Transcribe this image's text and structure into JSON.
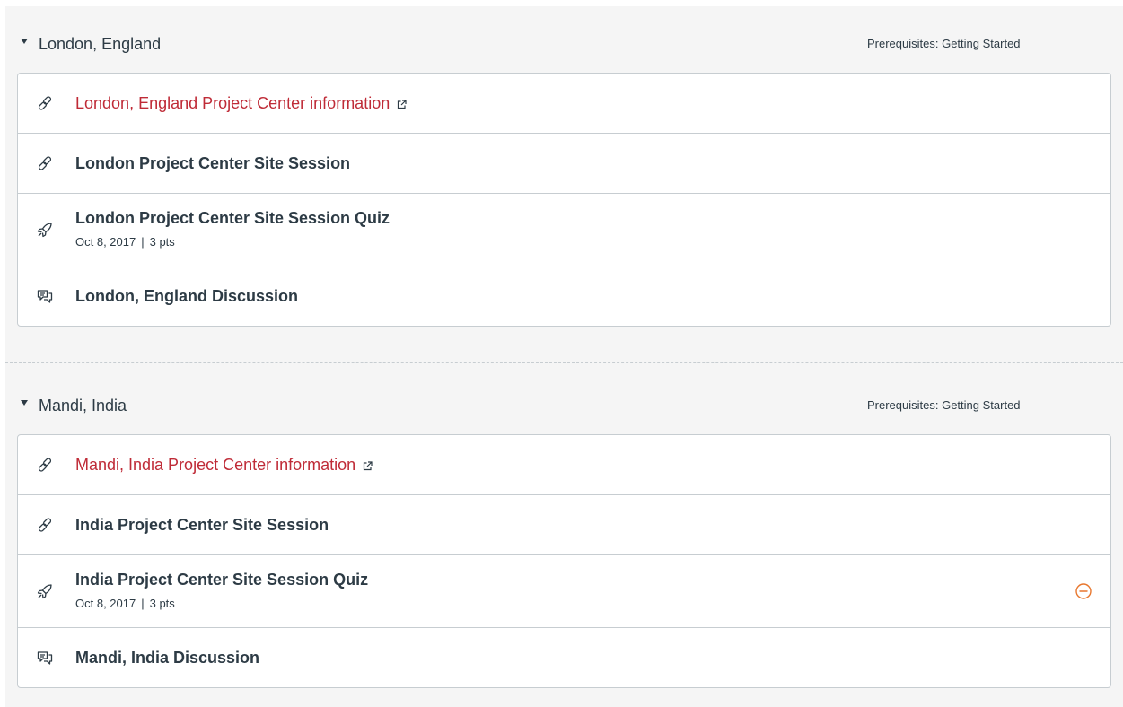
{
  "colors": {
    "link": "#bf2b37",
    "text": "#2d3b45",
    "border": "#c7cdd1",
    "background": "#f5f5f5",
    "status_warning": "#e8772e"
  },
  "modules": [
    {
      "title": "London, England",
      "prerequisites": "Prerequisites: Getting Started",
      "items": [
        {
          "icon": "link-icon",
          "title": "London, England Project Center information",
          "external": true
        },
        {
          "icon": "link-icon",
          "title": "London Project Center Site Session"
        },
        {
          "icon": "quiz-rocket-icon",
          "title": "London Project Center Site Session Quiz",
          "date": "Oct 8, 2017",
          "separator": "|",
          "points": "3 pts"
        },
        {
          "icon": "discussion-icon",
          "title": "London, England Discussion"
        }
      ]
    },
    {
      "title": "Mandi, India",
      "prerequisites": "Prerequisites: Getting Started",
      "items": [
        {
          "icon": "link-icon",
          "title": "Mandi, India Project Center information",
          "external": true
        },
        {
          "icon": "link-icon",
          "title": "India Project Center Site Session"
        },
        {
          "icon": "quiz-rocket-icon",
          "title": "India Project Center Site Session Quiz",
          "date": "Oct 8, 2017",
          "separator": "|",
          "points": "3 pts",
          "status_icon": "minus-circle-icon"
        },
        {
          "icon": "discussion-icon",
          "title": "Mandi, India Discussion"
        }
      ]
    }
  ]
}
